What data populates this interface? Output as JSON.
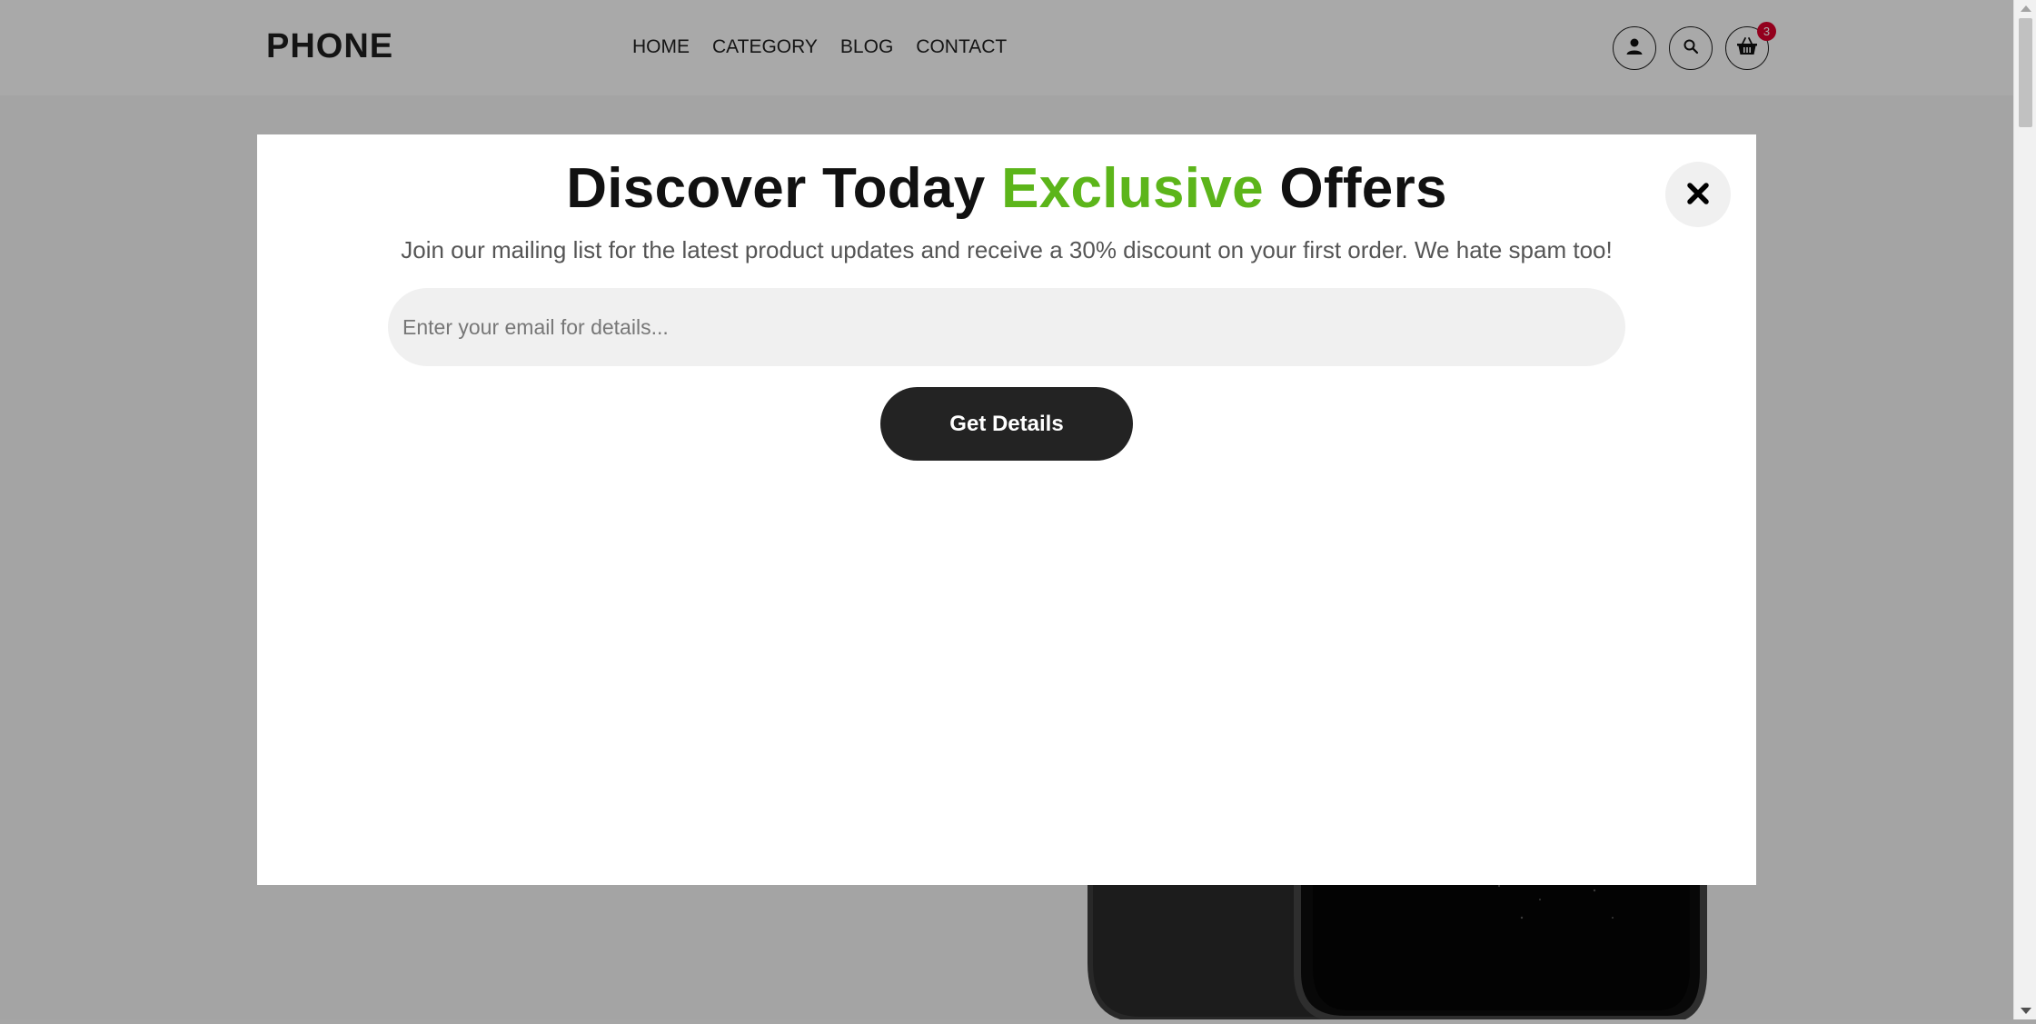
{
  "header": {
    "logo": "PHONE",
    "nav": [
      {
        "label": "HOME"
      },
      {
        "label": "CATEGORY"
      },
      {
        "label": "BLOG"
      },
      {
        "label": "CONTACT"
      }
    ],
    "icons": {
      "account": "user-icon",
      "search": "search-icon",
      "cart": "basket-icon"
    },
    "cart_count": "3"
  },
  "modal": {
    "title_part1": "Discover Today",
    "title_accent": "Exclusive",
    "title_part2": "Offers",
    "subtitle": "Join our mailing list for the latest product updates and receive a 30% discount on your first order. We hate spam too!",
    "email_placeholder": "Enter your email for details...",
    "submit_label": "Get Details",
    "close_icon": "close-icon"
  },
  "colors": {
    "accent": "#5cb51a",
    "button_bg": "#232323",
    "badge": "#d9002b"
  }
}
